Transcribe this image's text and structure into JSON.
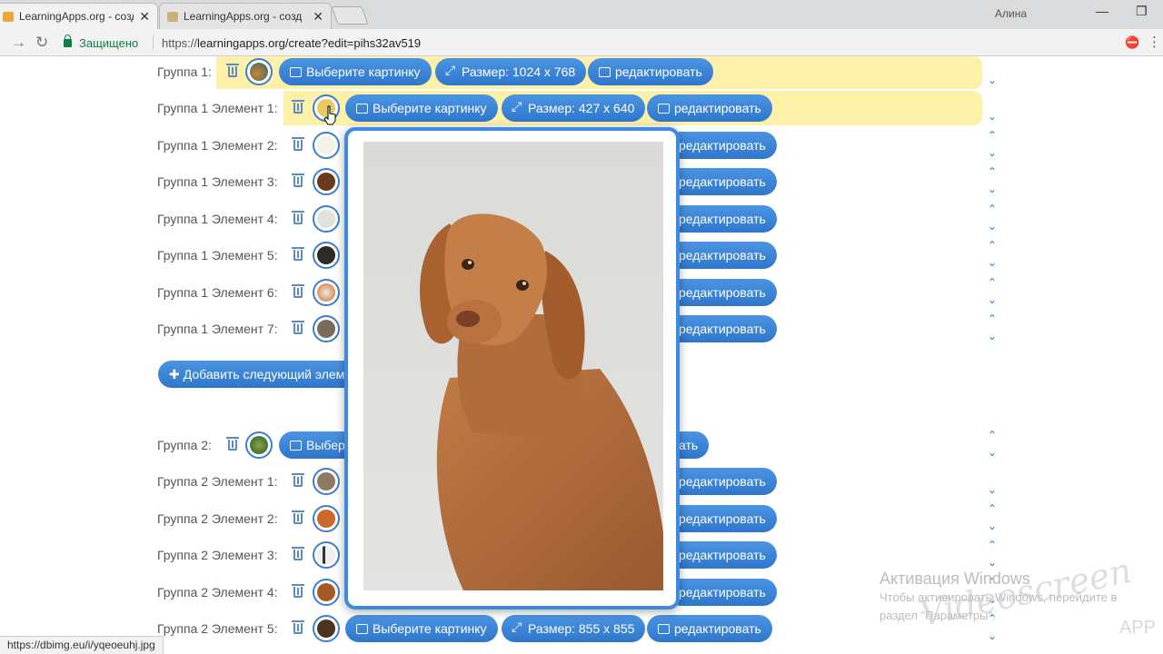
{
  "browser": {
    "tabs": [
      {
        "title": "LearningApps.org - созд",
        "active": true
      },
      {
        "title": "LearningApps.org - созд",
        "active": false
      }
    ],
    "user": "Алина",
    "secure_label": "Защищено",
    "url_prefix": "https://",
    "url_rest": "learningapps.org/create?edit=pihs32av519"
  },
  "buttons": {
    "choose_image": "Выберите картинку",
    "edit": "редактировать",
    "add_next_element": "Добавить следующий элем"
  },
  "group1": {
    "label": "Группа 1:",
    "size": "Размер: 1024 x 768",
    "elements": [
      {
        "label": "Группа 1 Элемент 1:",
        "size": "Размер: 427 x 640",
        "thumb": "dog-icon"
      },
      {
        "label": "Группа 1 Элемент 2:",
        "thumb": "llama-icon"
      },
      {
        "label": "Группа 1 Элемент 3:",
        "thumb": "horse-icon"
      },
      {
        "label": "Группа 1 Элемент 4:",
        "thumb": "goose-icon"
      },
      {
        "label": "Группа 1 Элемент 5:",
        "thumb": "cow-icon"
      },
      {
        "label": "Группа 1 Элемент 6:",
        "thumb": "guinea-pig-icon"
      },
      {
        "label": "Группа 1 Элемент 7:",
        "thumb": "cat-icon"
      }
    ]
  },
  "group2": {
    "label": "Группа 2:",
    "choose_image_truncated": "Выбер",
    "edit_truncated": "ать",
    "elements": [
      {
        "label": "Группа 2 Элемент 1:",
        "thumb": "wolf-icon"
      },
      {
        "label": "Группа 2 Элемент 2:",
        "thumb": "fox-icon"
      },
      {
        "label": "Группа 2 Элемент 3:",
        "thumb": "badger-icon"
      },
      {
        "label": "Группа 2 Элемент 4:",
        "thumb": "squirrel-icon"
      },
      {
        "label": "Группа 2 Элемент 5:",
        "size": "Размер: 855 x 855",
        "thumb": "bear-icon"
      }
    ]
  },
  "row_edit_partial": "редактировать",
  "status_url": "https://dbimg.eu/i/yqeoeuhj.jpg",
  "activation": {
    "title": "Активация Windows",
    "line1": "Чтобы активировать Windows, перейдите в",
    "line2": "раздел \"Параметры\"."
  },
  "watermark": {
    "script": "Videoscreen",
    "app": "APP"
  },
  "colors": {
    "button": "#3d86d9",
    "highlight": "#fdf0a8",
    "popup_border": "#3d8be0"
  }
}
